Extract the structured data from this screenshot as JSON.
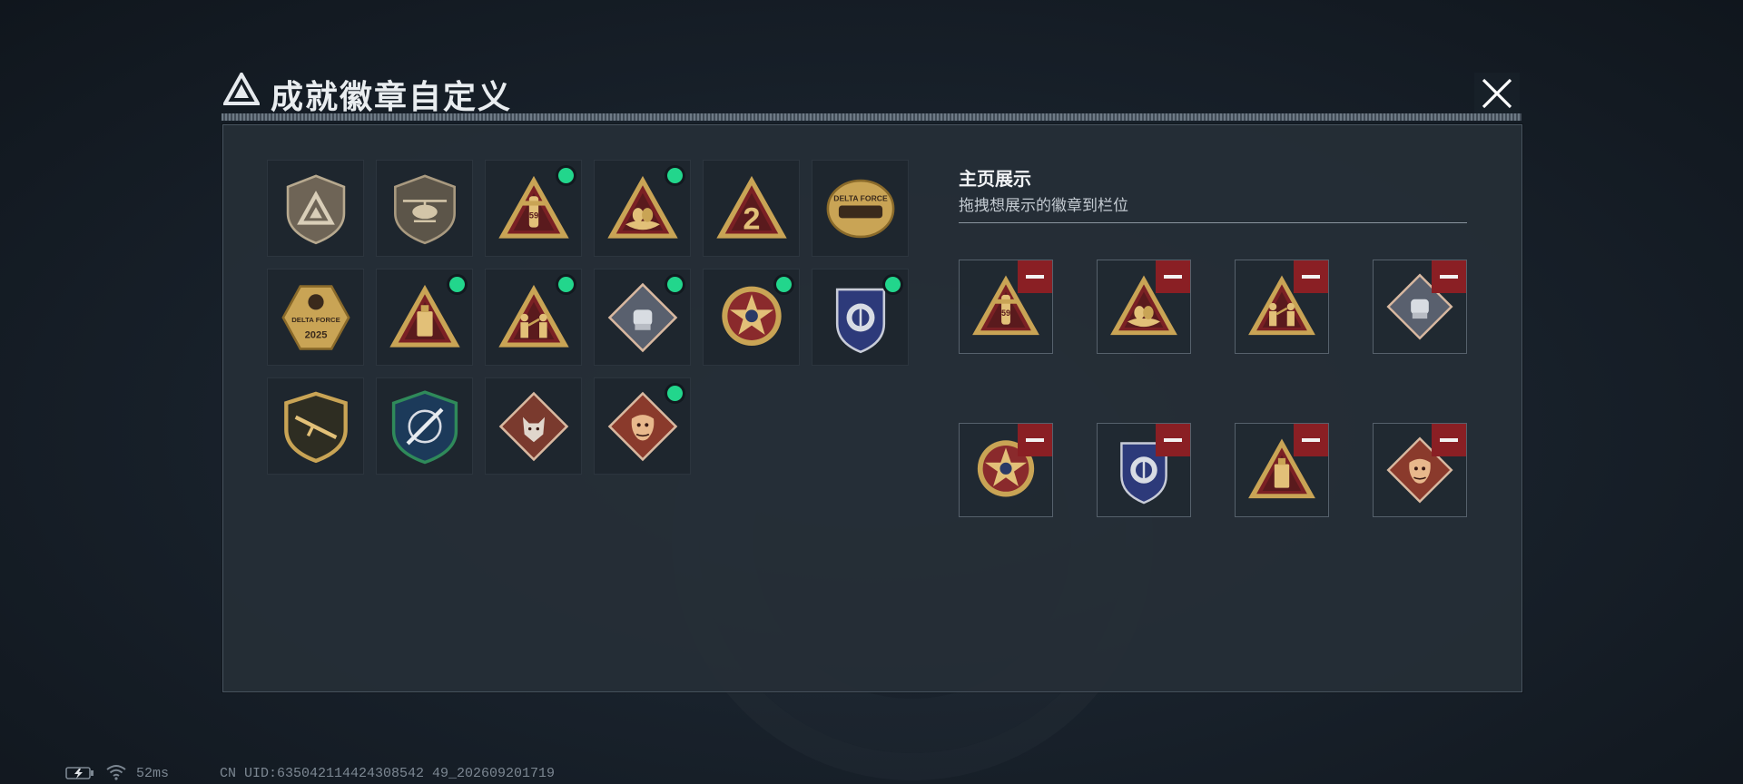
{
  "window": {
    "title": "成就徽章自定义",
    "logo_icon": "delta-logo-icon",
    "close_icon": "close-icon"
  },
  "colors": {
    "accent_new": "#22d68c",
    "remove_red": "#8a1f24",
    "gold": "#c9a455"
  },
  "badges": [
    {
      "icon": "delta-shield-badge-icon",
      "is_new": false
    },
    {
      "icon": "helicopter-badge-icon",
      "is_new": false
    },
    {
      "icon": "missile-59-badge-icon",
      "is_new": true
    },
    {
      "icon": "golden-eggs-badge-icon",
      "is_new": true
    },
    {
      "icon": "number-2-badge-icon",
      "is_new": false
    },
    {
      "icon": "delta-force-train-badge-icon",
      "is_new": false,
      "text": "DELTA FORCE"
    },
    {
      "icon": "delta-force-2025-badge-icon",
      "is_new": false,
      "text": "DELTA FORCE",
      "year": "2025"
    },
    {
      "icon": "usb-drive-badge-icon",
      "is_new": true
    },
    {
      "icon": "soldiers-badge-icon",
      "is_new": true
    },
    {
      "icon": "fist-diamond-badge-icon",
      "is_new": true
    },
    {
      "icon": "star-medal-badge-icon",
      "is_new": true
    },
    {
      "icon": "police-shield-badge-icon",
      "is_new": true
    },
    {
      "icon": "rifle-shield-badge-icon",
      "is_new": false
    },
    {
      "icon": "crosshair-knife-badge-icon",
      "is_new": false
    },
    {
      "icon": "wolf-diamond-badge-icon",
      "is_new": false
    },
    {
      "icon": "dragon-diamond-badge-icon",
      "is_new": true
    }
  ],
  "showcase": {
    "title": "主页展示",
    "subtitle": "拖拽想展示的徽章到栏位",
    "remove_icon": "minus-icon",
    "slots": [
      {
        "icon": "missile-59-badge-icon"
      },
      {
        "icon": "golden-eggs-badge-icon"
      },
      {
        "icon": "soldiers-badge-icon"
      },
      {
        "icon": "fist-diamond-badge-icon"
      },
      {
        "icon": "star-medal-badge-icon"
      },
      {
        "icon": "police-shield-badge-icon"
      },
      {
        "icon": "usb-drive-badge-icon"
      },
      {
        "icon": "dragon-diamond-badge-icon"
      }
    ]
  },
  "footer": {
    "battery_icon": "battery-charging-icon",
    "wifi_icon": "wifi-icon",
    "ping": "52ms",
    "uid": "CN UID:635042114424308542 49_202609201719"
  }
}
